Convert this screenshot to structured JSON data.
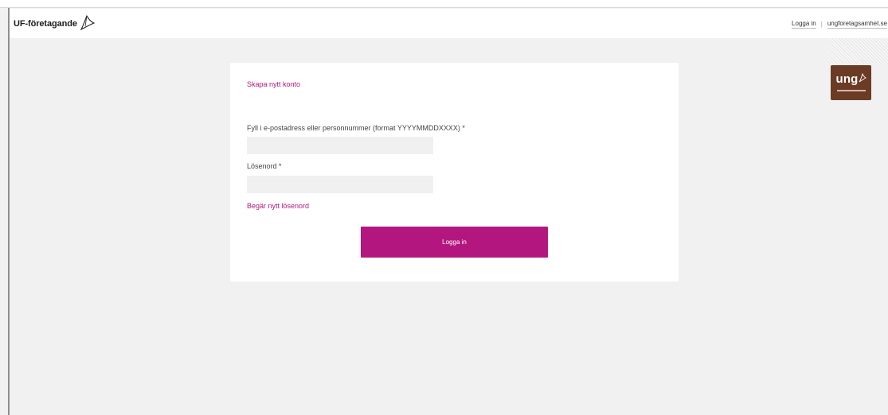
{
  "header": {
    "logo_text": "UF-företagande",
    "links": [
      {
        "label": "Logga in"
      },
      {
        "label": "ungforetagsamhet.se"
      }
    ],
    "separator": "|"
  },
  "badge": {
    "text": "ung"
  },
  "login_form": {
    "create_account_link": "Skapa nytt konto",
    "email_label": "Fyll i e-postadress eller personnummer (format YYYYMMDDXXXX) *",
    "email_value": "",
    "password_label": "Lösenord *",
    "password_value": "",
    "forgot_password_link": "Begär nytt lösenord",
    "submit_label": "Logga in"
  },
  "colors": {
    "accent": "#b3177f",
    "link": "#b0197e",
    "page_background": "#f1f1f1",
    "badge_background": "#6b3b25"
  }
}
